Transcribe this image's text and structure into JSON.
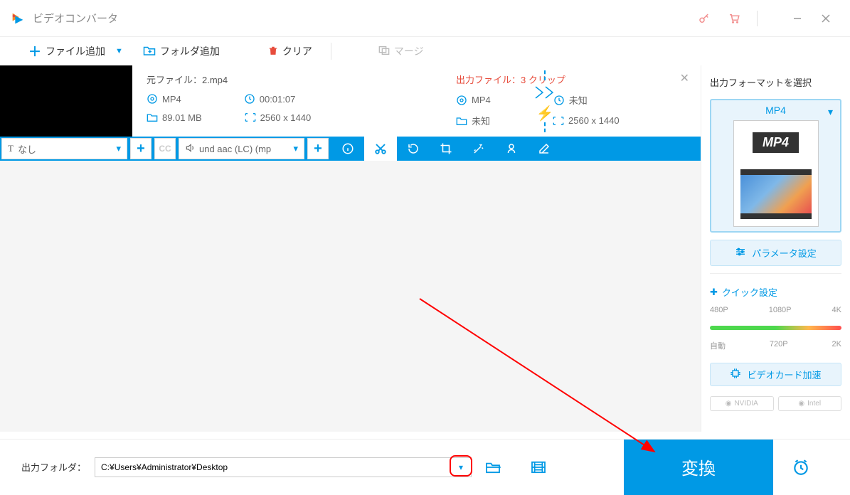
{
  "titlebar": {
    "title": "ビデオコンバータ"
  },
  "toolbar": {
    "add_file": "ファイル追加",
    "add_folder": "フォルダ追加",
    "clear": "クリア",
    "merge": "マージ"
  },
  "file": {
    "src_label": "元ファイル：",
    "src_name": "2.mp4",
    "out_label": "出力ファイル：",
    "out_count": "3 クリップ",
    "src_format": "MP4",
    "duration": "00:01:07",
    "size": "89.01 MB",
    "src_res": "2560 x 1440",
    "out_format": "MP4",
    "out_duration": "未知",
    "out_size": "未知",
    "out_res": "2560 x 1440"
  },
  "strip": {
    "subtitle": "なし",
    "audio": "und aac (LC) (mp"
  },
  "sidebar": {
    "title": "出力フォーマットを選択",
    "format": "MP4",
    "format_badge": "MP4",
    "param": "パラメータ設定",
    "quick": "クイック設定",
    "q_top": {
      "a": "480P",
      "b": "1080P",
      "c": "4K"
    },
    "q_bot": {
      "a": "自動",
      "b": "720P",
      "c": "2K"
    },
    "gpu": "ビデオカード加速",
    "nvidia": "NVIDIA",
    "intel": "Intel"
  },
  "footer": {
    "label": "出力フォルダ：",
    "path": "C:¥Users¥Administrator¥Desktop",
    "convert": "変換"
  }
}
